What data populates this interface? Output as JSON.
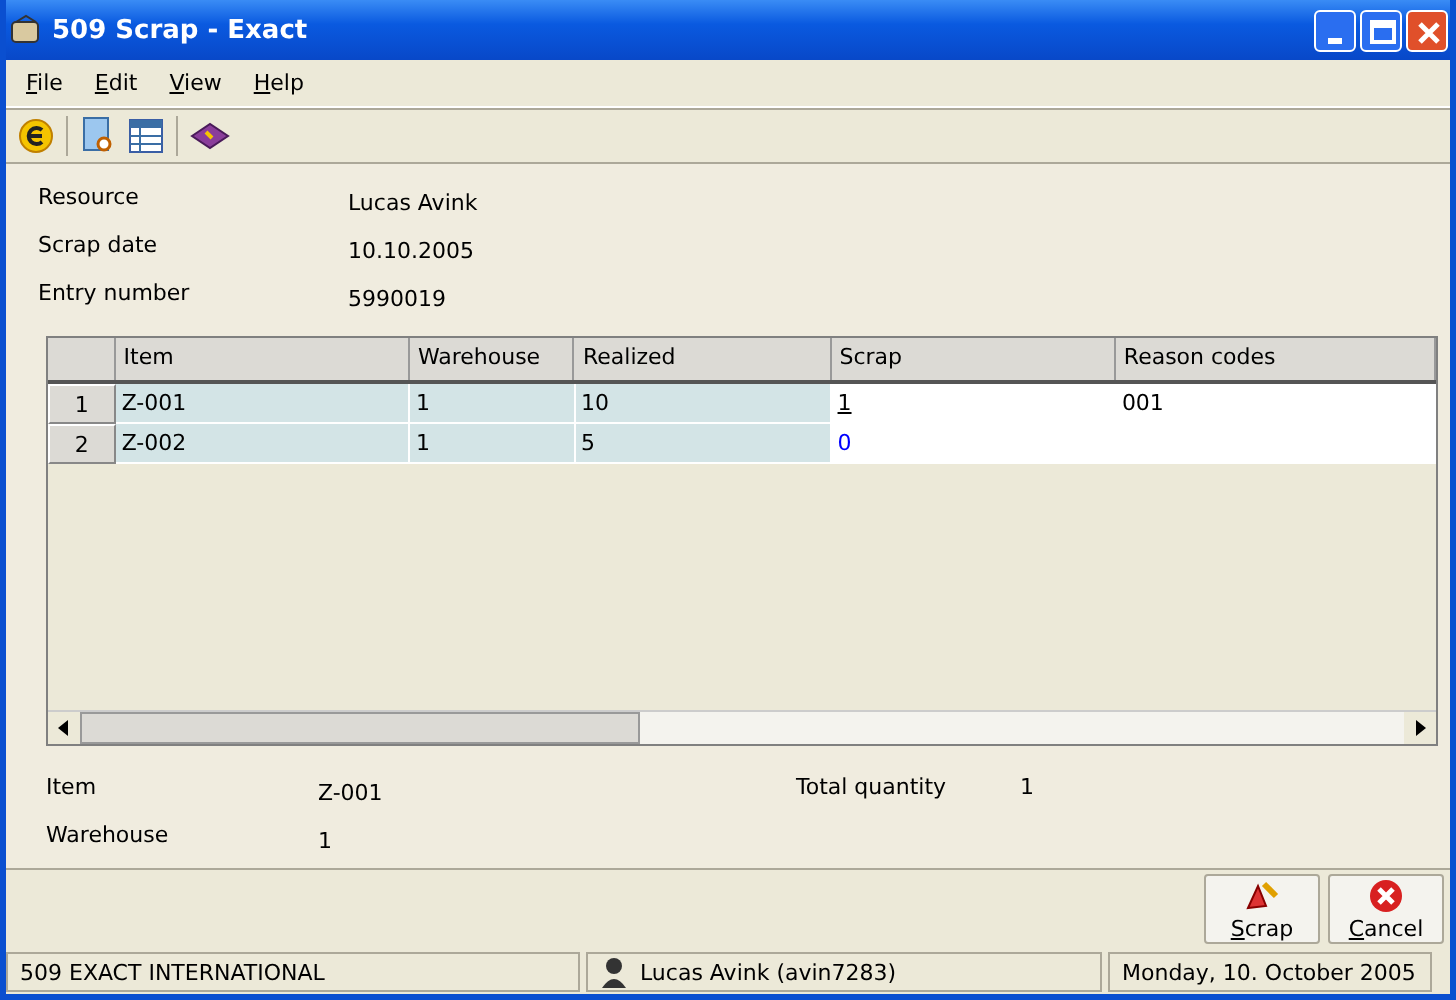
{
  "window": {
    "title": "509 Scrap - Exact"
  },
  "menu": [
    {
      "label": "File"
    },
    {
      "label": "Edit"
    },
    {
      "label": "View"
    },
    {
      "label": "Help"
    }
  ],
  "header": [
    {
      "label": "Resource",
      "value": "Lucas Avink"
    },
    {
      "label": "Scrap date",
      "value": "10.10.2005"
    },
    {
      "label": "Entry number",
      "value": "5990019"
    }
  ],
  "table": {
    "columns": [
      "Item",
      "Warehouse",
      "Realized",
      "Scrap",
      "Reason codes"
    ],
    "rows": [
      {
        "number": "1",
        "cells": [
          "Z-001",
          "1",
          "10",
          "1",
          "001"
        ],
        "selected": true
      },
      {
        "number": "2",
        "cells": [
          "Z-002",
          "1",
          "5",
          "0",
          ""
        ],
        "selected": false
      }
    ]
  },
  "details": {
    "item_label": "Item",
    "item": "Z-001",
    "warehouse_label": "Warehouse",
    "warehouse": "1",
    "total_label": "Total quantity",
    "total": "1"
  },
  "buttons": [
    {
      "kind": "scrap",
      "label": "Scrap"
    },
    {
      "kind": "cancel",
      "label": "Cancel"
    }
  ],
  "status_bar": {
    "company": "509 EXACT INTERNATIONAL",
    "user": "Lucas Avink (avin7283)",
    "date": "Monday, 10. October 2005"
  }
}
